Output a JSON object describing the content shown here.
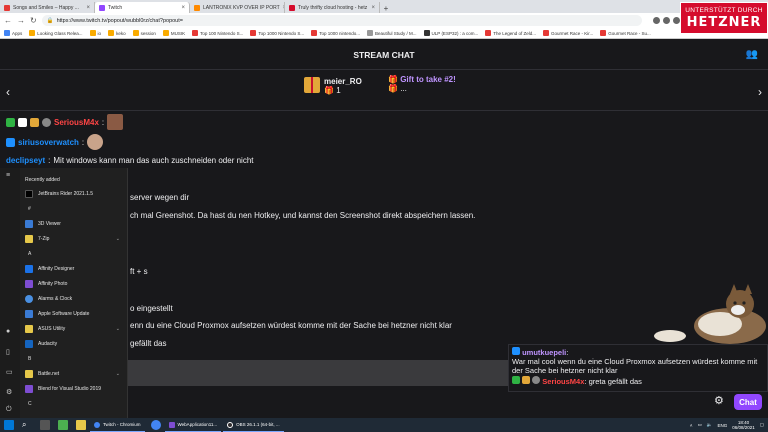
{
  "browser": {
    "tabs": [
      {
        "title": "Songs and Smiles – Happy ...",
        "color": "#e53935"
      },
      {
        "title": "Twitch",
        "color": "#9147ff"
      },
      {
        "title": "LANTRONIX KVP OVER IP PORT",
        "color": "#ff8a00"
      },
      {
        "title": "Truly thrifty cloud hosting - hetz",
        "color": "#d50c2d"
      }
    ],
    "new_tab": "+",
    "url": "https://www.twitch.tv/popout/wubbl0rz/chat?popout=",
    "bookmarks": [
      "Apps",
      "Looking Glass Relea...",
      "io",
      "keko",
      "session",
      "MUSIK",
      "Top 100 Nintendo S...",
      "Top 1000 Nintendo S...",
      "Top 1000 nintendo...",
      "Beautiful Study / M...",
      "ULP (ESP32) : a com...",
      "The Legend of Zeld...",
      "Gourmet Race - Kir...",
      "Gourmet Race - Su..."
    ]
  },
  "sponsor": {
    "line1": "UNTERSTÜTZT DURCH",
    "logo": "HETZNER"
  },
  "chat": {
    "header": "STREAM CHAT",
    "gift1": {
      "user": "meier_RO",
      "count": "1"
    },
    "gift2": {
      "label": "Gift to take #2!",
      "sub": "..."
    },
    "messages": [
      {
        "user": "SeriousM4x",
        "text": "",
        "color": "#ff4545"
      },
      {
        "user": "siriusoverwatch",
        "text": "",
        "color": "#1e90ff"
      },
      {
        "user": "declipseyt",
        "text": "Mit windows kann man das auch zuschneiden oder nicht",
        "color": "#1e90ff"
      }
    ],
    "fragments": [
      "server wegen dir",
      "ch mal Greenshot. Da hast du nen Hotkey, und kannst den Screenshot direkt abspeichern lassen.",
      "ft + s",
      "o eingestellt",
      "enn du eine Cloud Proxmox aufsetzen würdest komme mit der Sache bei hetzner nicht klar",
      "gefällt das"
    ],
    "popup": {
      "user1": "umutkuepeli",
      "text1": "War mal cool wenn du eine Cloud Proxmox aufsetzen würdest komme mit der Sache bei hetzner nicht klar",
      "user2": "SeriousM4x",
      "text2": "greta gefällt das"
    },
    "chat_button": "Chat"
  },
  "startmenu": {
    "header": "Recently added",
    "items": [
      {
        "label": "JetBrains Rider 2021.1.5",
        "color": "#000000"
      },
      {
        "label": "#",
        "letter": true
      },
      {
        "label": "3D Viewer",
        "color": "#3a7bd5"
      },
      {
        "label": "7-Zip",
        "color": "#e6c84a",
        "folder": true
      },
      {
        "label": "A",
        "letter": true
      },
      {
        "label": "Affinity Designer",
        "color": "#1b72e8"
      },
      {
        "label": "Affinity Photo",
        "color": "#7e4dd2"
      },
      {
        "label": "Alarms & Clock",
        "color": "#4a90e2"
      },
      {
        "label": "Apple Software Update",
        "color": "#3a7bd5"
      },
      {
        "label": "ASUS Utility",
        "color": "#e6c84a",
        "folder": true
      },
      {
        "label": "Audacity",
        "color": "#1565c0"
      },
      {
        "label": "B",
        "letter": true
      },
      {
        "label": "Battle.net",
        "color": "#e6c84a",
        "folder": true
      },
      {
        "label": "Blend for Visual Studio 2019",
        "color": "#7e4dd2"
      },
      {
        "label": "C",
        "letter": true
      }
    ]
  },
  "taskbar": {
    "apps": [
      "Twitch - Chromium",
      "WebApplication11...",
      "OBS 26.1.1 (64-bit, ..."
    ],
    "lang": "ENG",
    "time": "18:40",
    "date": "06/08/2021"
  }
}
